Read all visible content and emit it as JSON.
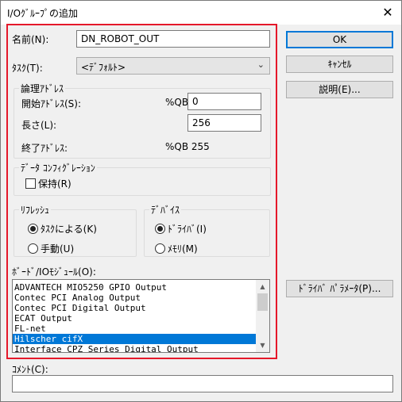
{
  "window": {
    "title": "I/Oｸﾞﾙｰﾌﾟの追加",
    "close_glyph": "✕"
  },
  "name": {
    "label": "名前(N):",
    "value": "DN_ROBOT_OUT"
  },
  "task": {
    "label": "ﾀｽｸ(T):",
    "value": "<ﾃﾞﾌｫﾙﾄ>",
    "arrow": "⌄"
  },
  "logical_address": {
    "group_label": "論理ｱﾄﾞﾚｽ",
    "start_label": "開始ｱﾄﾞﾚｽ(S):",
    "start_prefix": "%QB",
    "start_value": "0",
    "length_label": "長さ(L):",
    "length_value": "256",
    "end_label": "終了ｱﾄﾞﾚｽ:",
    "end_value": "%QB 255"
  },
  "data_config": {
    "group_label": "ﾃﾞｰﾀ ｺﾝﾌｨｸﾞﾚｰｼｮﾝ",
    "hold_label": "保持(R)",
    "hold_checked": false
  },
  "refresh": {
    "group_label": "ﾘﾌﾚｯｼｭ",
    "options": [
      {
        "label": "ﾀｽｸによる(K)",
        "selected": true
      },
      {
        "label": "手動(U)",
        "selected": false
      }
    ]
  },
  "device": {
    "group_label": "ﾃﾞﾊﾞｲｽ",
    "options": [
      {
        "label": "ﾄﾞﾗｲﾊﾞ(I)",
        "selected": true
      },
      {
        "label": "ﾒﾓﾘ(M)",
        "selected": false
      }
    ]
  },
  "board_module": {
    "label": "ﾎﾞｰﾄﾞ/IOﾓｼﾞｭｰﾙ(O):",
    "items": [
      "ADVANTECH MIO5250 GPIO Output",
      "Contec PCI Analog Output",
      "Contec PCI Digital Output",
      "ECAT Output",
      "FL-net",
      "Hilscher cifX",
      "Interface CPZ Series Digital Output"
    ],
    "selected_index": 5
  },
  "comment": {
    "label": "ｺﾒﾝﾄ(C):",
    "value": ""
  },
  "buttons": {
    "ok": "OK",
    "cancel": "ｷｬﾝｾﾙ",
    "description": "説明(E)...",
    "driver_params": "ﾄﾞﾗｲﾊﾞ ﾊﾟﾗﾒｰﾀ(P)..."
  },
  "colors": {
    "highlight_frame": "#e5182a",
    "selection": "#0078d7"
  }
}
